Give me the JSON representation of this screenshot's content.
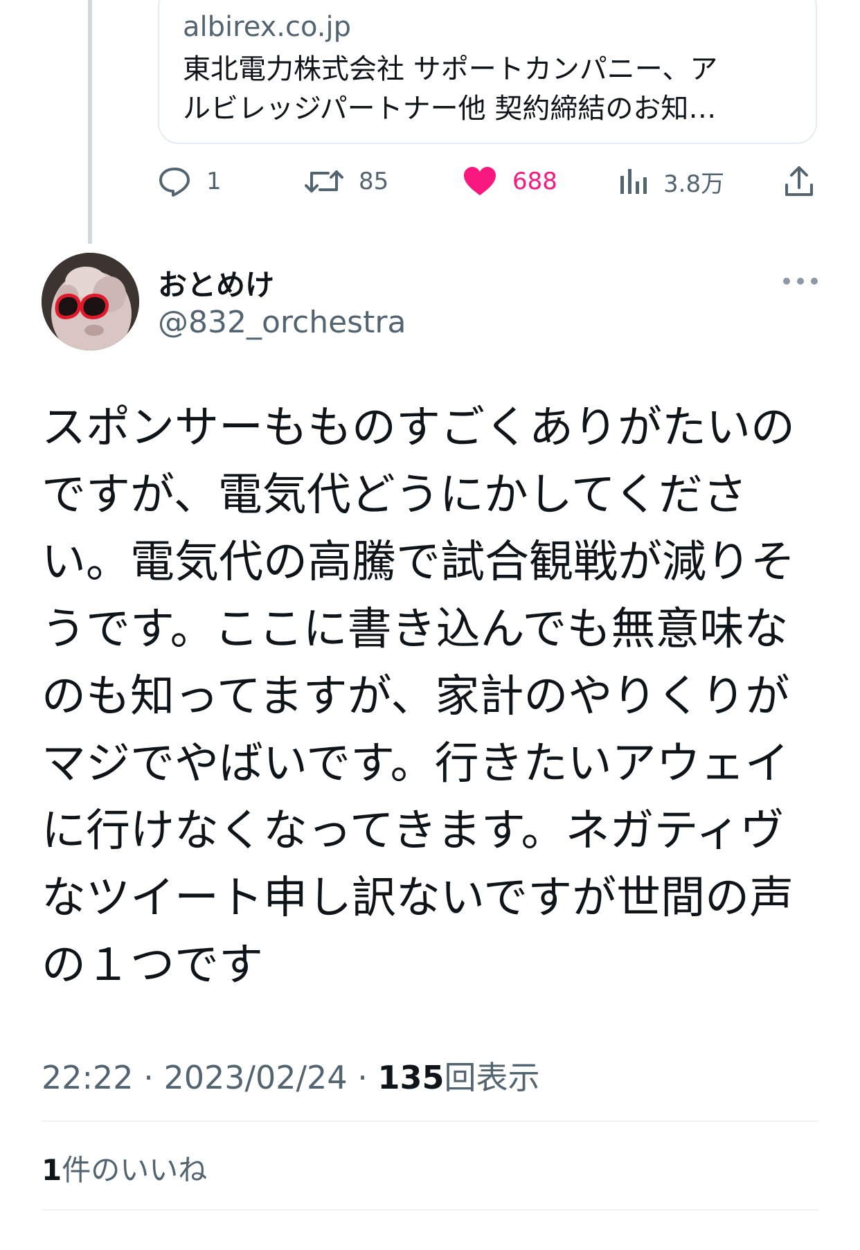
{
  "link_card": {
    "domain": "albirex.co.jp",
    "title_line1": "東北電力株式会社 サポートカンパニー、ア",
    "title_line2": "ルビレッジパートナー他 契約締結のお知…"
  },
  "parent_actions": {
    "replies": "1",
    "retweets": "85",
    "likes": "688",
    "views": "3.8万",
    "like_color": "#f91880"
  },
  "author": {
    "name": "おとめけ",
    "handle": "@832_orchestra"
  },
  "tweet": {
    "lines": [
      "スポンサーもものすごくありがたいの",
      "ですが、電気代どうにかしてくださ",
      "い。電気代の高騰で試合観戦が減りそ",
      "うです。ここに書き込んでも無意味な",
      "のも知ってますが、家計のやりくりが",
      "マジでやばいです。行きたいアウェイ",
      "に行けなくなってきます。ネガティヴ",
      "なツイート申し訳ないですが世間の声",
      "の１つです"
    ]
  },
  "meta": {
    "time": "22:22",
    "separator": "·",
    "date": "2023/02/24",
    "views_count": "135",
    "views_label": "回表示"
  },
  "likes_row": {
    "count": "1",
    "label": "件のいいね"
  }
}
